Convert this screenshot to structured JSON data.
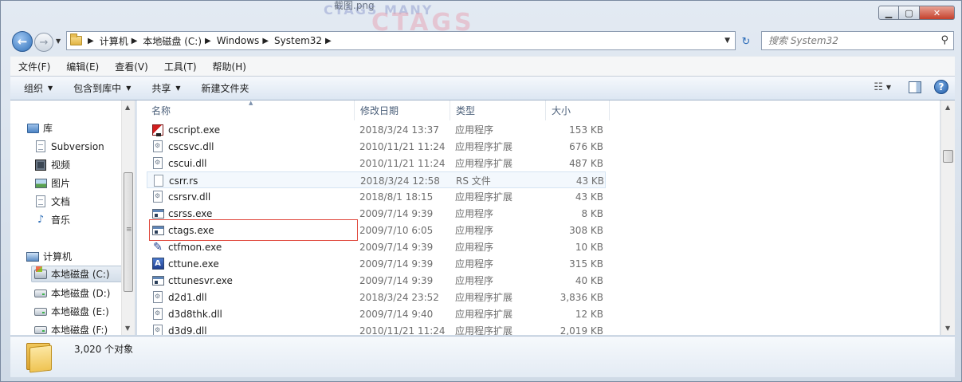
{
  "window": {
    "title": "截图.png",
    "bg_banner_small": "CTAGS MANY",
    "bg_banner_large": "CTAGS",
    "buttons": {
      "minimize": "▁",
      "maximize": "▢",
      "close": "✕"
    }
  },
  "address": {
    "crumbs": [
      "计算机",
      "本地磁盘 (C:)",
      "Windows",
      "System32"
    ],
    "search_placeholder": "搜索 System32"
  },
  "menu": [
    "文件(F)",
    "编辑(E)",
    "查看(V)",
    "工具(T)",
    "帮助(H)"
  ],
  "toolbar": {
    "organize": "组织",
    "include_in_library": "包含到库中",
    "share": "共享",
    "new_folder": "新建文件夹"
  },
  "nav": {
    "libraries_header": "库",
    "libraries": [
      "Subversion",
      "视频",
      "图片",
      "文档",
      "音乐"
    ],
    "computer_header": "计算机",
    "drives": [
      "本地磁盘 (C:)",
      "本地磁盘 (D:)",
      "本地磁盘 (E:)",
      "本地磁盘 (F:)"
    ],
    "selected": "本地磁盘 (C:)"
  },
  "columns": {
    "name": "名称",
    "date": "修改日期",
    "type": "类型",
    "size": "大小"
  },
  "files": [
    {
      "name": "cscript.exe",
      "date": "2018/3/24 13:37",
      "type": "应用程序",
      "size": "153 KB",
      "icon": "script-icon"
    },
    {
      "name": "cscsvc.dll",
      "date": "2010/11/21 11:24",
      "type": "应用程序扩展",
      "size": "676 KB",
      "icon": "dll-icon"
    },
    {
      "name": "cscui.dll",
      "date": "2010/11/21 11:24",
      "type": "应用程序扩展",
      "size": "487 KB",
      "icon": "dll-icon"
    },
    {
      "name": "csrr.rs",
      "date": "2018/3/24 12:58",
      "type": "RS 文件",
      "size": "43 KB",
      "icon": "file-icon"
    },
    {
      "name": "csrsrv.dll",
      "date": "2018/8/1 18:15",
      "type": "应用程序扩展",
      "size": "43 KB",
      "icon": "dll-icon"
    },
    {
      "name": "csrss.exe",
      "date": "2009/7/14 9:39",
      "type": "应用程序",
      "size": "8 KB",
      "icon": "exe-icon"
    },
    {
      "name": "ctags.exe",
      "date": "2009/7/10 6:05",
      "type": "应用程序",
      "size": "308 KB",
      "icon": "exe-icon"
    },
    {
      "name": "ctfmon.exe",
      "date": "2009/7/14 9:39",
      "type": "应用程序",
      "size": "10 KB",
      "icon": "pen-icon"
    },
    {
      "name": "cttune.exe",
      "date": "2009/7/14 9:39",
      "type": "应用程序",
      "size": "315 KB",
      "icon": "font-icon"
    },
    {
      "name": "cttunesvr.exe",
      "date": "2009/7/14 9:39",
      "type": "应用程序",
      "size": "40 KB",
      "icon": "exe-icon"
    },
    {
      "name": "d2d1.dll",
      "date": "2018/3/24 23:52",
      "type": "应用程序扩展",
      "size": "3,836 KB",
      "icon": "dll-icon"
    },
    {
      "name": "d3d8thk.dll",
      "date": "2009/7/14 9:40",
      "type": "应用程序扩展",
      "size": "12 KB",
      "icon": "dll-icon"
    },
    {
      "name": "d3d9.dll",
      "date": "2010/11/21 11:24",
      "type": "应用程序扩展",
      "size": "2,019 KB",
      "icon": "dll-icon"
    }
  ],
  "status": {
    "item_count": "3,020 个对象"
  },
  "colors": {
    "highlight_box": "#e0483d",
    "accent": "#2f6fb8"
  }
}
